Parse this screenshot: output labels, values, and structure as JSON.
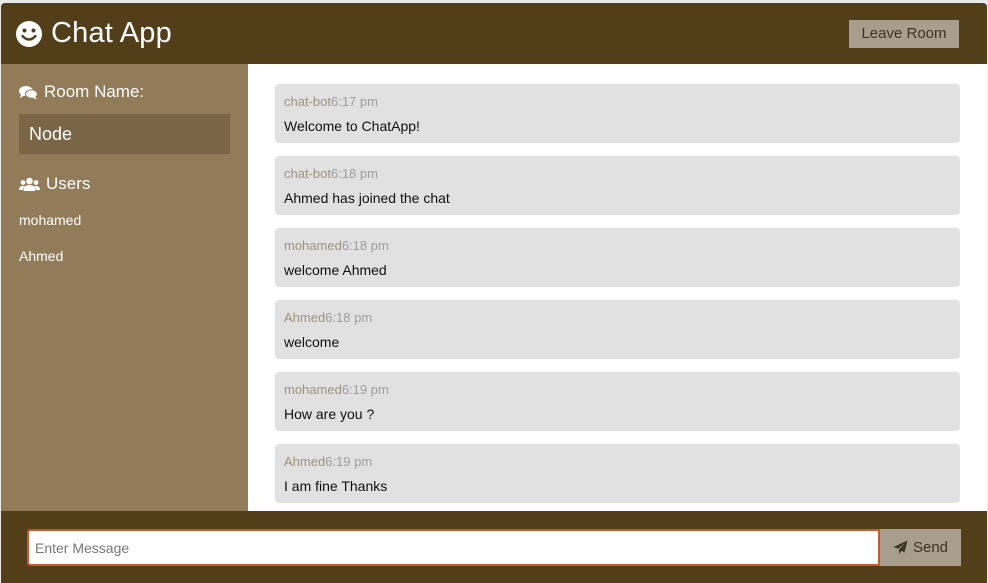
{
  "header": {
    "logo_icon": "smile-icon",
    "title": "Chat App",
    "leave_label": "Leave Room"
  },
  "sidebar": {
    "room_heading": "Room Name:",
    "room_icon": "comments-icon",
    "room_name": "Node",
    "users_heading": "Users",
    "users_icon": "users-icon",
    "users": [
      "mohamed",
      "Ahmed"
    ]
  },
  "messages": [
    {
      "user": "chat-bot",
      "time": "6:17 pm",
      "text": "Welcome to ChatApp!"
    },
    {
      "user": "chat-bot",
      "time": "6:18 pm",
      "text": "Ahmed has joined the chat"
    },
    {
      "user": "mohamed",
      "time": "6:18 pm",
      "text": "welcome Ahmed"
    },
    {
      "user": "Ahmed",
      "time": "6:18 pm",
      "text": "welcome"
    },
    {
      "user": "mohamed",
      "time": "6:19 pm",
      "text": "How are you ?"
    },
    {
      "user": "Ahmed",
      "time": "6:19 pm",
      "text": "I am fine Thanks"
    }
  ],
  "composer": {
    "placeholder": "Enter Message",
    "value": "",
    "send_label": "Send",
    "send_icon": "paper-plane-icon"
  },
  "colors": {
    "header_bg": "#533e1a",
    "sidebar_bg": "#917b58",
    "room_box_bg": "#7a6546",
    "message_bg": "#e1e1e1",
    "button_bg": "#a89e8d",
    "input_border": "#c6592f"
  }
}
